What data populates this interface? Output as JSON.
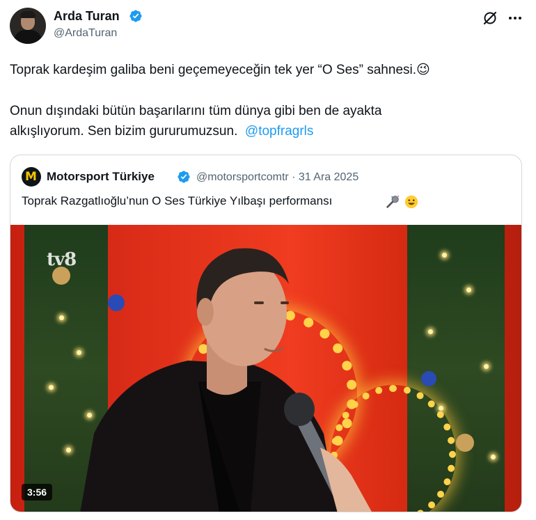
{
  "author": {
    "display_name": "Arda Turan",
    "handle": "@ArdaTuran"
  },
  "tweet": {
    "line1": "Toprak kardeşim galiba beni geçemeyeceğin tek yer “O Ses” sahnesi.😉",
    "line2": "Onun dışındaki bütün başarılarını tüm dünya gibi ben de ayakta",
    "line3_text": "alkışlıyorum. Sen bizim gururumuzsun.",
    "mention": "@topfragrls"
  },
  "quoted": {
    "display_name": "Motorsport Türkiye",
    "meta": "@motorsportcomtr · 31 Ara 2025",
    "text": "Toprak Razgatlıoğlu’nun O Ses Türkiye Yılbaşı performansı",
    "avatar_letter": "M",
    "video": {
      "watermark": "tv8",
      "duration": "3:56"
    }
  },
  "colors": {
    "verified": "#1d9bf0",
    "mention": "#1d9bf0",
    "secondary_text": "#536471"
  },
  "icons": [
    "verified-badge-icon",
    "grok-icon",
    "more-icon",
    "microphone-emoji-icon",
    "smile-emoji-icon"
  ]
}
